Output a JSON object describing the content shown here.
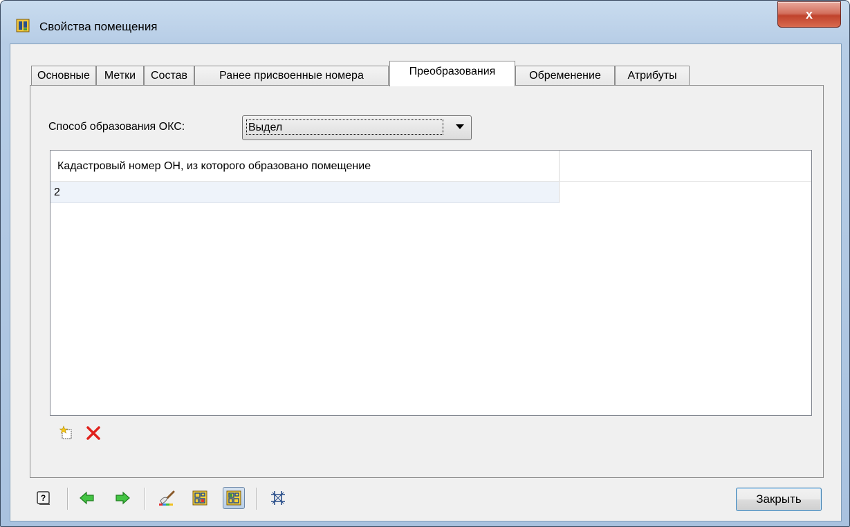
{
  "window": {
    "title": "Свойства помещения",
    "close_glyph": "x"
  },
  "tabs": [
    {
      "label": "Основные"
    },
    {
      "label": "Метки"
    },
    {
      "label": "Состав"
    },
    {
      "label": "Ранее присвоенные номера"
    },
    {
      "label": "Преобразования",
      "active": true
    },
    {
      "label": "Обременение"
    },
    {
      "label": "Атрибуты"
    }
  ],
  "form": {
    "method_label": "Способ образования ОКС:",
    "method_value": "Выдел"
  },
  "grid": {
    "columns": [
      "Кадастровый номер ОН, из которого образовано помещение"
    ],
    "rows": [
      [
        "2"
      ]
    ]
  },
  "grid_tools": {
    "add_icon": "new-row-icon",
    "delete_icon": "delete-row-icon"
  },
  "bottom_toolbar": {
    "icons": [
      "help-icon",
      "back-arrow-icon",
      "forward-arrow-icon",
      "brush-icon",
      "map-icon",
      "map-active-icon",
      "grid-crop-icon"
    ],
    "close_label": "Закрыть"
  },
  "colors": {
    "arrow_green": "#2fae2f",
    "delete_red": "#e0201b"
  }
}
